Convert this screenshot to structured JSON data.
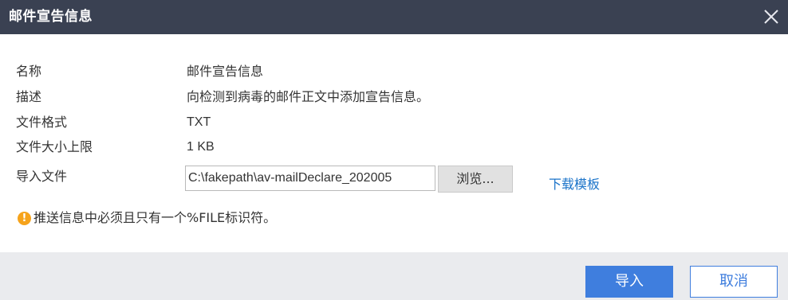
{
  "dialog": {
    "title": "邮件宣告信息",
    "close_icon": "close-icon"
  },
  "fields": [
    {
      "label": "名称",
      "value": "邮件宣告信息"
    },
    {
      "label": "描述",
      "value": "向检测到病毒的邮件正文中添加宣告信息。"
    },
    {
      "label": "文件格式",
      "value": "TXT"
    },
    {
      "label": "文件大小上限",
      "value": "1 KB"
    }
  ],
  "import_file": {
    "label": "导入文件",
    "value": "C:\\fakepath\\av-mailDeclare_202005",
    "browse_label": "浏览...",
    "download_template_label": "下载模板"
  },
  "notice": {
    "icon": "warning-icon",
    "icon_glyph": "!",
    "text": "推送信息中必须且只有一个%FILE标识符。"
  },
  "footer": {
    "import_label": "导入",
    "cancel_label": "取消"
  },
  "colors": {
    "title_bar": "#3a4152",
    "primary": "#3f7ede",
    "link": "#1a73c9",
    "warning": "#f6a31b",
    "footer_bg": "#eaebee"
  }
}
